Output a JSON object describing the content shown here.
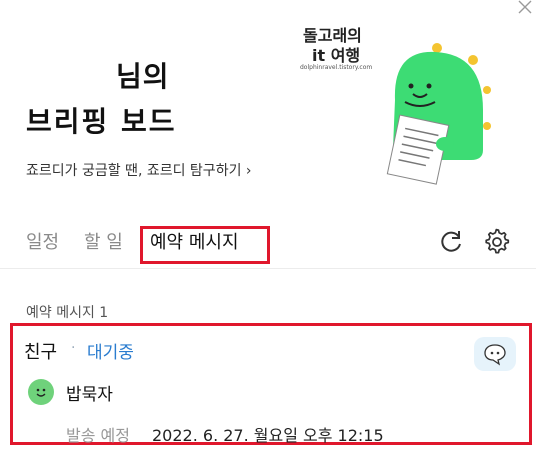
{
  "header": {
    "title_line1": "님의",
    "title_line2": "브리핑 보드",
    "sub_link": "죠르디가 궁금할 땐, 죠르디 탐구하기 ›"
  },
  "watermark": {
    "line1": "돌고래의",
    "line2": "it 여행",
    "line3": "dolphinravel.tistory.com"
  },
  "tabs": [
    {
      "label": "일정",
      "active": false
    },
    {
      "label": "할 일",
      "active": false
    },
    {
      "label": "예약 메시지",
      "active": true
    }
  ],
  "section": {
    "label": "예약 메시지 1"
  },
  "message": {
    "recipient": "친구",
    "separator": "·",
    "status": "대기중",
    "person": "밥묵자",
    "schedule_label": "발송 예정",
    "schedule_time": "2022. 6. 27. 월요일 오후 12:15"
  },
  "icons": {
    "close": "close-icon",
    "refresh": "refresh-icon",
    "settings": "gear-icon",
    "chat": "chat-bubble-icon"
  },
  "colors": {
    "highlight": "#e0172c",
    "status": "#2a7ccf",
    "mascot": "#3ddc74"
  }
}
